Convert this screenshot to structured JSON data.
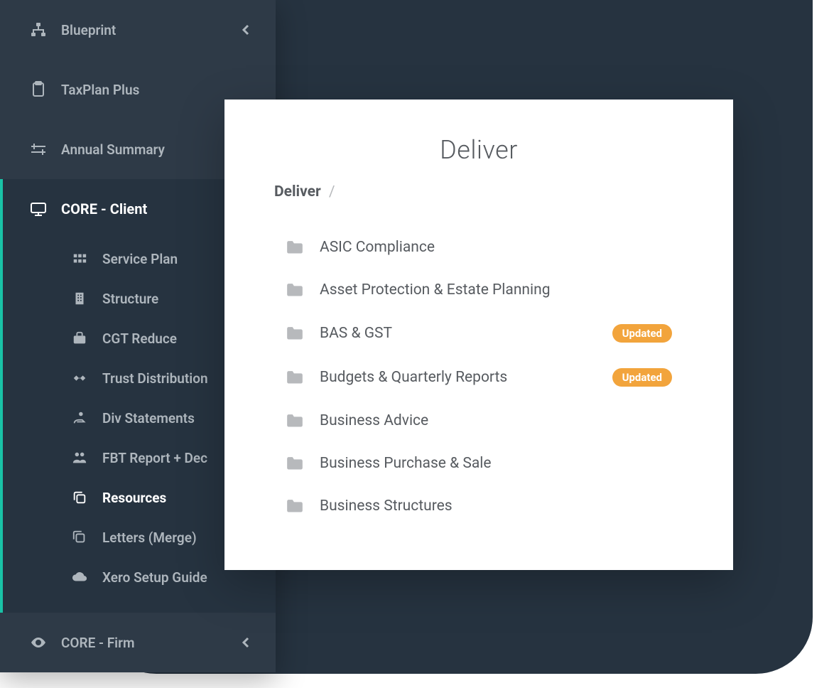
{
  "sidebar": {
    "items": [
      {
        "label": "Blueprint",
        "icon": "hierarchy-icon",
        "chevron": true
      },
      {
        "label": "TaxPlan Plus",
        "icon": "clipboard-icon",
        "chevron": false
      },
      {
        "label": "Annual Summary",
        "icon": "timeline-icon",
        "chevron": false
      }
    ],
    "active_section": {
      "label": "CORE - Client",
      "icon": "monitor-icon",
      "sub": [
        {
          "label": "Service Plan",
          "icon": "grid-icon"
        },
        {
          "label": "Structure",
          "icon": "building-icon"
        },
        {
          "label": "CGT Reduce",
          "icon": "briefcase-icon"
        },
        {
          "label": "Trust Distribution",
          "icon": "handshake-icon"
        },
        {
          "label": "Div Statements",
          "icon": "hand-coin-icon"
        },
        {
          "label": "FBT Report + Dec",
          "icon": "people-icon"
        },
        {
          "label": "Resources",
          "icon": "copy-icon",
          "active": true
        },
        {
          "label": "Letters (Merge)",
          "icon": "stack-icon"
        },
        {
          "label": "Xero Setup Guide",
          "icon": "cloud-icon"
        }
      ]
    },
    "bottom": {
      "label": "CORE - Firm",
      "icon": "eye-icon",
      "chevron": true
    }
  },
  "content": {
    "title": "Deliver",
    "breadcrumb": {
      "root": "Deliver",
      "sep": "/"
    },
    "folders": [
      {
        "label": "ASIC Compliance"
      },
      {
        "label": "Asset Protection & Estate Planning"
      },
      {
        "label": "BAS & GST",
        "badge": "Updated"
      },
      {
        "label": "Budgets & Quarterly Reports",
        "badge": "Updated"
      },
      {
        "label": "Business Advice"
      },
      {
        "label": "Business Purchase & Sale"
      },
      {
        "label": "Business Structures"
      }
    ]
  },
  "colors": {
    "sidebar_bg": "#2e3a47",
    "sidebar_dark": "#263340",
    "accent_teal": "#19c3a7",
    "badge_orange": "#f2a43c",
    "text_dark": "#575b60",
    "text_muted": "#aeb6bd"
  }
}
